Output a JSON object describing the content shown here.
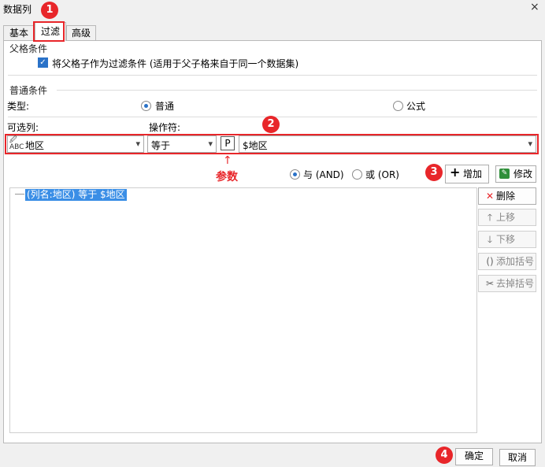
{
  "window": {
    "title": "数据列",
    "close": "×"
  },
  "tabs": [
    {
      "label": "基本"
    },
    {
      "label": "过滤"
    },
    {
      "label": "高级"
    }
  ],
  "parent": {
    "section": "父格条件",
    "checkbox_label": "将父格子作为过滤条件 (适用于父子格来自于同一个数据集)",
    "checked": true
  },
  "normal": {
    "section": "普通条件",
    "type_label": "类型:",
    "type_options": [
      "普通",
      "公式"
    ],
    "type_selected": "普通",
    "column_label": "可选列:",
    "operator_label": "操作符:",
    "column_value": "地区",
    "operator_value": "等于",
    "param_button": "P",
    "param_value": "$地区",
    "param_caption": "参数",
    "logic": [
      {
        "label": "与 (AND)"
      },
      {
        "label": "或 (OR)"
      }
    ],
    "logic_selected": "与 (AND)",
    "add_label": "增加",
    "edit_label": "修改"
  },
  "conditions": [
    "(列名:地区) 等于 $地区"
  ],
  "side_buttons": [
    {
      "label": "删除",
      "icon": "delete-icon"
    },
    {
      "label": "上移",
      "icon": "arrow-up-icon"
    },
    {
      "label": "下移",
      "icon": "arrow-down-icon"
    },
    {
      "label": "添加括号",
      "icon": "add-parenthesis-icon"
    },
    {
      "label": "去掉括号",
      "icon": "remove-parenthesis-icon"
    }
  ],
  "footer": {
    "ok": "确定",
    "cancel": "取消"
  },
  "badges": [
    "1",
    "2",
    "3",
    "4"
  ],
  "colors": {
    "accent_red": "#e8262a",
    "selection_blue": "#3a8ee6",
    "checkbox_blue": "#2a72c8"
  }
}
